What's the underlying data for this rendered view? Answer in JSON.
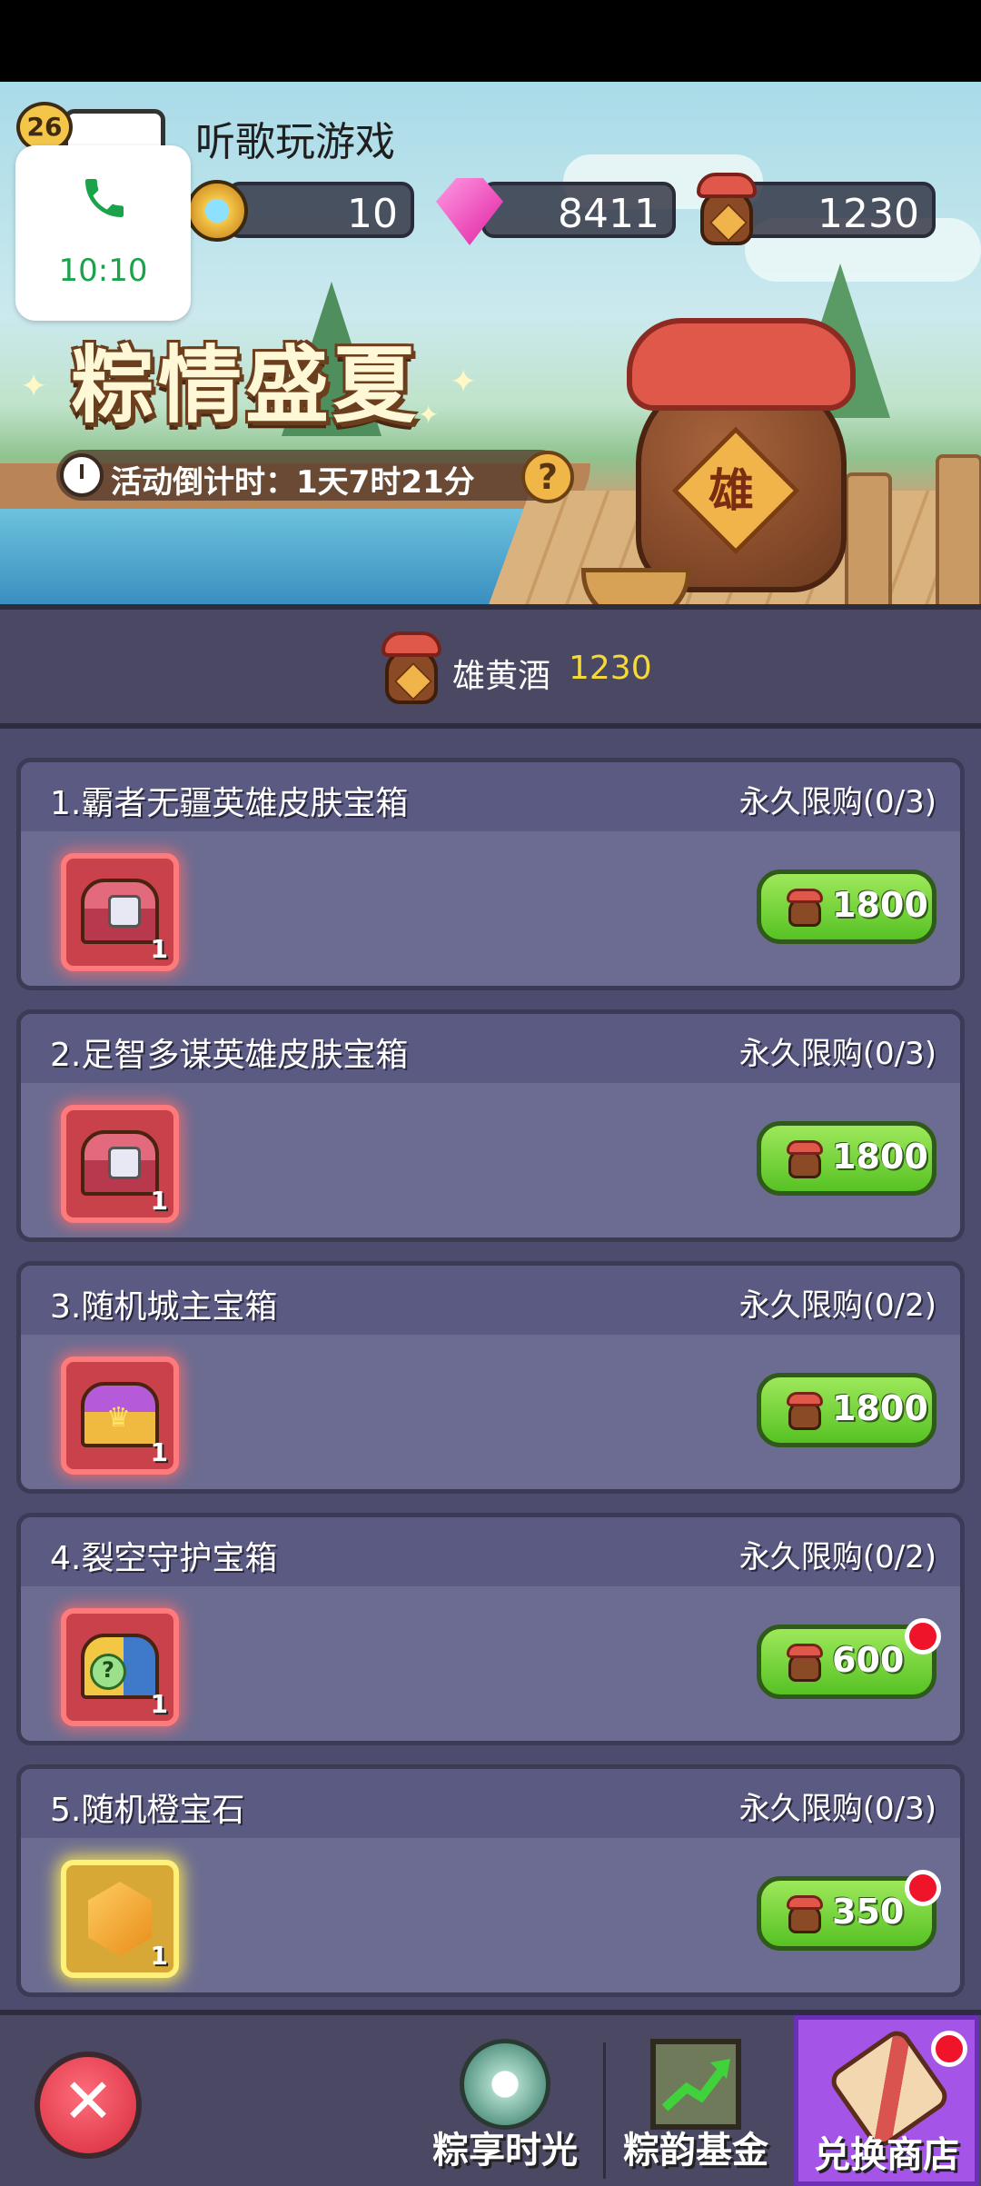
{
  "player": {
    "level": "26",
    "name": "听歌玩游戏"
  },
  "call_notification": {
    "time": "10:10",
    "icon": "phone-icon",
    "color": "#1aa34a"
  },
  "resources": {
    "coins": "10",
    "gems": "8411",
    "wine": "1230"
  },
  "banner": {
    "title": "粽情盛夏",
    "jar_char": "雄",
    "countdown": "活动倒计时：1天7时21分",
    "help": "?"
  },
  "currency_header": {
    "label": "雄黄酒",
    "amount": "1230"
  },
  "items": [
    {
      "name": "1.霸者无疆英雄皮肤宝箱",
      "limit": "永久限购(0/3)",
      "qty": "1",
      "price": "1800",
      "icon": "skin-chest-icon"
    },
    {
      "name": "2.足智多谋英雄皮肤宝箱",
      "limit": "永久限购(0/3)",
      "qty": "1",
      "price": "1800",
      "icon": "skin-chest-icon"
    },
    {
      "name": "3.随机城主宝箱",
      "limit": "永久限购(0/2)",
      "qty": "1",
      "price": "1800",
      "icon": "lord-chest-icon"
    },
    {
      "name": "4.裂空守护宝箱",
      "limit": "永久限购(0/2)",
      "qty": "1",
      "price": "600",
      "icon": "guardian-chest-icon"
    },
    {
      "name": "5.随机橙宝石",
      "limit": "永久限购(0/3)",
      "qty": "1",
      "price": "350",
      "icon": "orange-gem-icon"
    }
  ],
  "nav": {
    "close": "✕",
    "tabs": [
      {
        "label": "粽享时光",
        "icon": "disc-icon"
      },
      {
        "label": "粽韵基金",
        "icon": "chart-icon"
      },
      {
        "label": "兑换商店",
        "icon": "scroll-icon"
      }
    ]
  },
  "colors": {
    "accent_amount": "#f5d93a",
    "buy_button": "#57c224",
    "active_tab": "#a454e6"
  }
}
